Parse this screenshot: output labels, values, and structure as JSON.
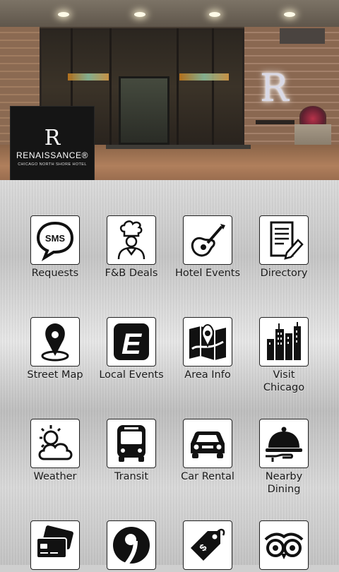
{
  "hotel": {
    "logo_mark": "R",
    "logo_name": "RENAISSANCE®",
    "logo_subtitle": "CHICAGO NORTH SHORE HOTEL",
    "sign_letter": "R"
  },
  "tiles": [
    {
      "label": "Requests",
      "icon": "sms-bubble-icon"
    },
    {
      "label": "F&B Deals",
      "icon": "chef-icon"
    },
    {
      "label": "Hotel Events",
      "icon": "guitar-icon"
    },
    {
      "label": "Directory",
      "icon": "document-pencil-icon"
    },
    {
      "label": "Street Map",
      "icon": "map-pin-icon"
    },
    {
      "label": "Local Events",
      "icon": "letter-e-icon"
    },
    {
      "label": "Area Info",
      "icon": "folded-map-icon"
    },
    {
      "label": "Visit\nChicago",
      "icon": "skyline-icon"
    },
    {
      "label": "Weather",
      "icon": "sun-cloud-icon"
    },
    {
      "label": "Transit",
      "icon": "bus-icon"
    },
    {
      "label": "Car Rental",
      "icon": "car-icon"
    },
    {
      "label": "Nearby\nDining",
      "icon": "serving-dish-icon"
    },
    {
      "label": "",
      "icon": "credit-cards-icon"
    },
    {
      "label": "",
      "icon": "number-nine-icon"
    },
    {
      "label": "",
      "icon": "price-tag-icon"
    },
    {
      "label": "",
      "icon": "owl-icon"
    }
  ]
}
